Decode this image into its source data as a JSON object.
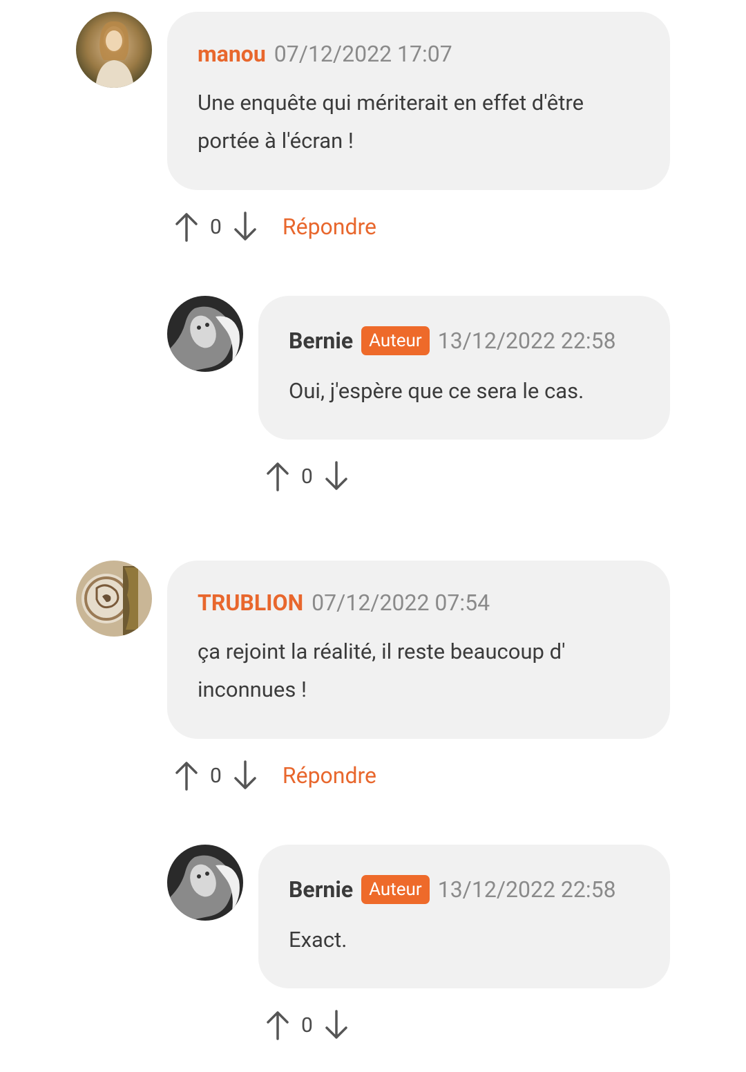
{
  "comments": [
    {
      "author": "manou",
      "date": "07/12/2022 17:07",
      "text_lines": [
        "Une enquête qui mériterait en effet d'être",
        "portée à l'écran !"
      ],
      "votes": "0",
      "reply_label": "Répondre"
    },
    {
      "author": "Bernie",
      "badge": "Auteur",
      "date": "13/12/2022 22:58",
      "text_lines": [
        "Oui, j'espère que ce sera le cas."
      ],
      "votes": "0"
    },
    {
      "author": "TRUBLION",
      "date": "07/12/2022 07:54",
      "text_lines": [
        "ça rejoint la réalité, il reste beaucoup d'",
        "inconnues !"
      ],
      "votes": "0",
      "reply_label": "Répondre"
    },
    {
      "author": "Bernie",
      "badge": "Auteur",
      "date": "13/12/2022 22:58",
      "text_lines": [
        "Exact."
      ],
      "votes": "0"
    }
  ],
  "colors": {
    "accent": "#e8672d",
    "badge_bg": "#ee6a2a",
    "bubble_bg": "#f1f1f1",
    "date_text": "#8a8a8a",
    "body_text": "#3b3b3b"
  },
  "icons": {
    "upvote": "arrow-up-icon",
    "downvote": "arrow-down-icon"
  }
}
